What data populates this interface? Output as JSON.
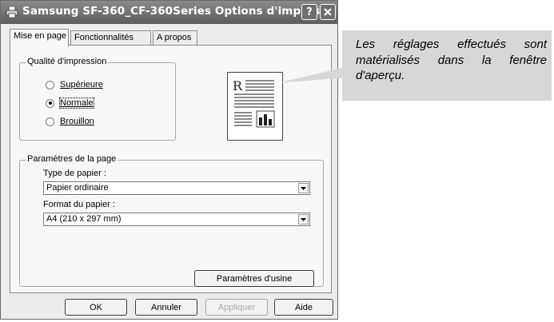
{
  "window": {
    "title": "Samsung SF-360_CF-360Series Options d'impres...",
    "help_label": "?",
    "close_label": "✕"
  },
  "tabs": [
    {
      "label": "Mise en page",
      "active": true
    },
    {
      "label": "Fonctionnalités",
      "active": false
    },
    {
      "label": "A propos",
      "active": false
    }
  ],
  "print_quality": {
    "legend": "Qualité d'impression",
    "options": [
      {
        "label": "Supérieure",
        "checked": false
      },
      {
        "label": "Normale",
        "checked": true
      },
      {
        "label": "Brouillon",
        "checked": false
      }
    ]
  },
  "page_settings": {
    "legend": "Paramètres de la page",
    "paper_type": {
      "label": "Type de papier :",
      "value": "Papier ordinaire"
    },
    "paper_size": {
      "label": "Format du papier :",
      "value": "A4 (210 x 297 mm)"
    },
    "defaults_button": "Paramètres d'usine"
  },
  "preview": {
    "letter": "R"
  },
  "footer_buttons": {
    "ok": "OK",
    "cancel": "Annuler",
    "apply": "Appliquer",
    "help": "Aide"
  },
  "callout": {
    "text": "Les réglages effectués sont matérialisés dans la fenêtre d'aperçu."
  },
  "colors": {
    "titlebar": "#6e6e6e",
    "dialog_bg": "#ececec",
    "callout_bg": "#d7d7d7"
  }
}
